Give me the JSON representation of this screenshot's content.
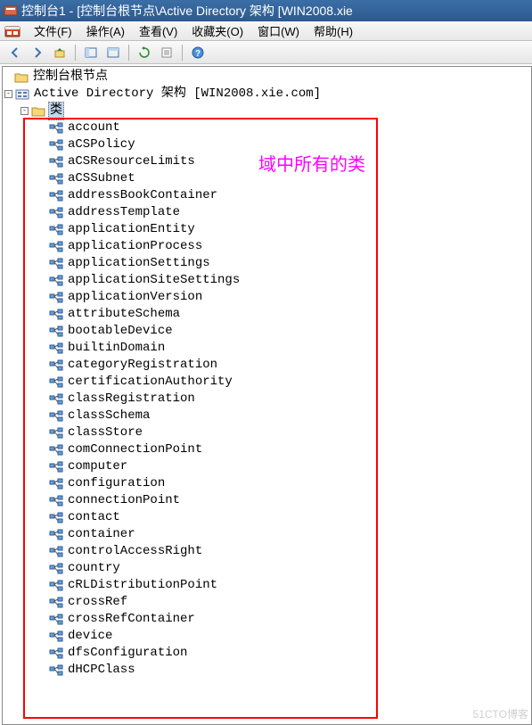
{
  "title": "控制台1 - [控制台根节点\\Active Directory 架构 [WIN2008.xie",
  "menu": {
    "file": "文件(F)",
    "action": "操作(A)",
    "view": "查看(V)",
    "favorites": "收藏夹(O)",
    "window": "窗口(W)",
    "help": "帮助(H)"
  },
  "tree": {
    "root": "控制台根节点",
    "schema_node": "Active Directory 架构 [WIN2008.xie.com]",
    "classes_folder": "类",
    "items": [
      "account",
      "aCSPolicy",
      "aCSResourceLimits",
      "aCSSubnet",
      "addressBookContainer",
      "addressTemplate",
      "applicationEntity",
      "applicationProcess",
      "applicationSettings",
      "applicationSiteSettings",
      "applicationVersion",
      "attributeSchema",
      "bootableDevice",
      "builtinDomain",
      "categoryRegistration",
      "certificationAuthority",
      "classRegistration",
      "classSchema",
      "classStore",
      "comConnectionPoint",
      "computer",
      "configuration",
      "connectionPoint",
      "contact",
      "container",
      "controlAccessRight",
      "country",
      "cRLDistributionPoint",
      "crossRef",
      "crossRefContainer",
      "device",
      "dfsConfiguration",
      "dHCPClass"
    ]
  },
  "annotation": "域中所有的类",
  "watermark": "51CTO博客"
}
